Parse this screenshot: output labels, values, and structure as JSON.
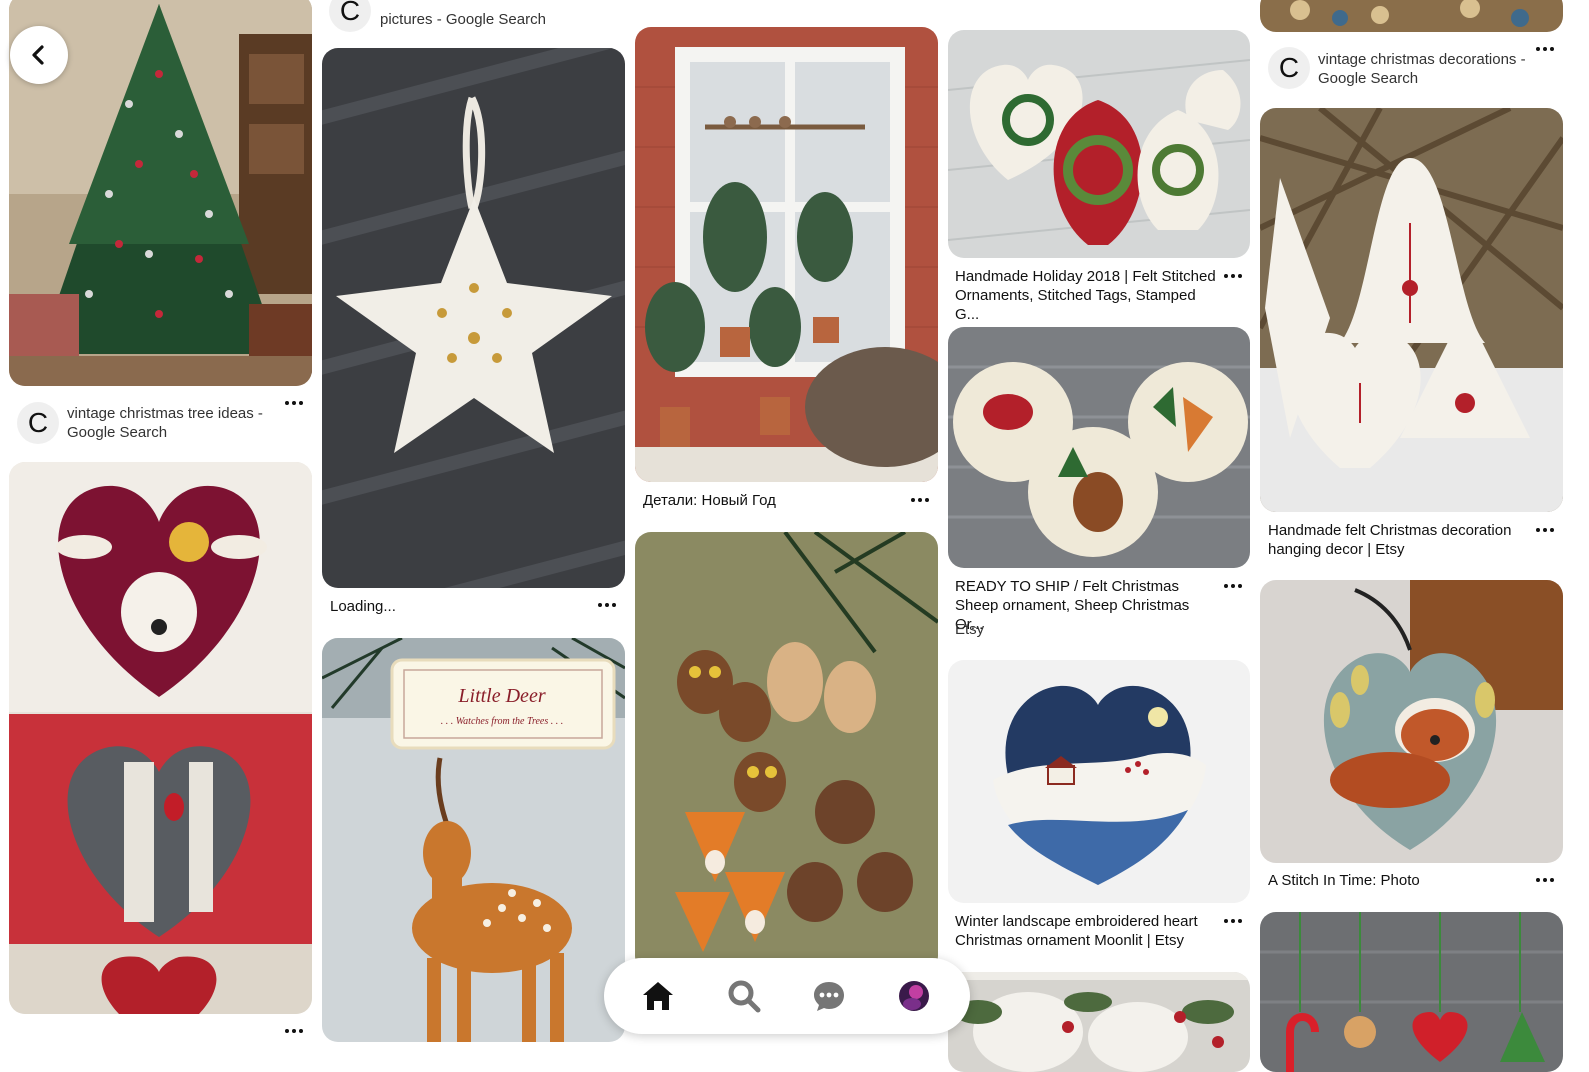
{
  "colors": {
    "accent": "#111111",
    "tree_green": "#1f4a2c",
    "felt_red": "#b3202a",
    "felt_white": "#f3efe6",
    "nav_inactive": "#767676"
  },
  "back_button": {
    "icon": "chevron-left-icon"
  },
  "columns": {
    "col1": {
      "pin1": {
        "source_letter": "C",
        "source_title": "vintage christmas tree ideas - Google Search"
      },
      "pin2": {}
    },
    "col2": {
      "header": {
        "source_letter": "C",
        "source_title": "pictures - Google Search"
      },
      "pin1": {
        "title": "Loading..."
      },
      "pin2": {
        "label_main": "Little Deer",
        "label_sub": ". . . Watches from the Trees . . ."
      }
    },
    "col3": {
      "pin1": {
        "title": "Детали: Новый Год"
      },
      "pin2": {}
    },
    "col4": {
      "pin1": {
        "title": "Handmade Holiday 2018 | Felt Stitched Ornaments, Stitched Tags, Stamped G..."
      },
      "pin2": {
        "title": "READY TO SHIP / Felt Christmas Sheep ornament, Sheep Christmas Or...",
        "source": "Etsy"
      },
      "pin3": {
        "title": "Winter landscape embroidered heart Christmas ornament Moonlit | Etsy"
      }
    },
    "col5": {
      "header": {
        "source_letter": "C",
        "source_title": "vintage christmas decorations - Google Search"
      },
      "pin1": {
        "title": "Handmade felt Christmas decoration hanging decor | Etsy"
      },
      "pin2": {
        "title": "A Stitch In Time: Photo"
      }
    }
  },
  "bottom_nav": {
    "items": [
      {
        "name": "home",
        "icon": "home-icon",
        "active": true
      },
      {
        "name": "search",
        "icon": "search-icon",
        "active": false
      },
      {
        "name": "messages",
        "icon": "chat-bubble-icon",
        "active": false
      },
      {
        "name": "profile",
        "icon": "avatar-icon",
        "active": false
      }
    ]
  }
}
